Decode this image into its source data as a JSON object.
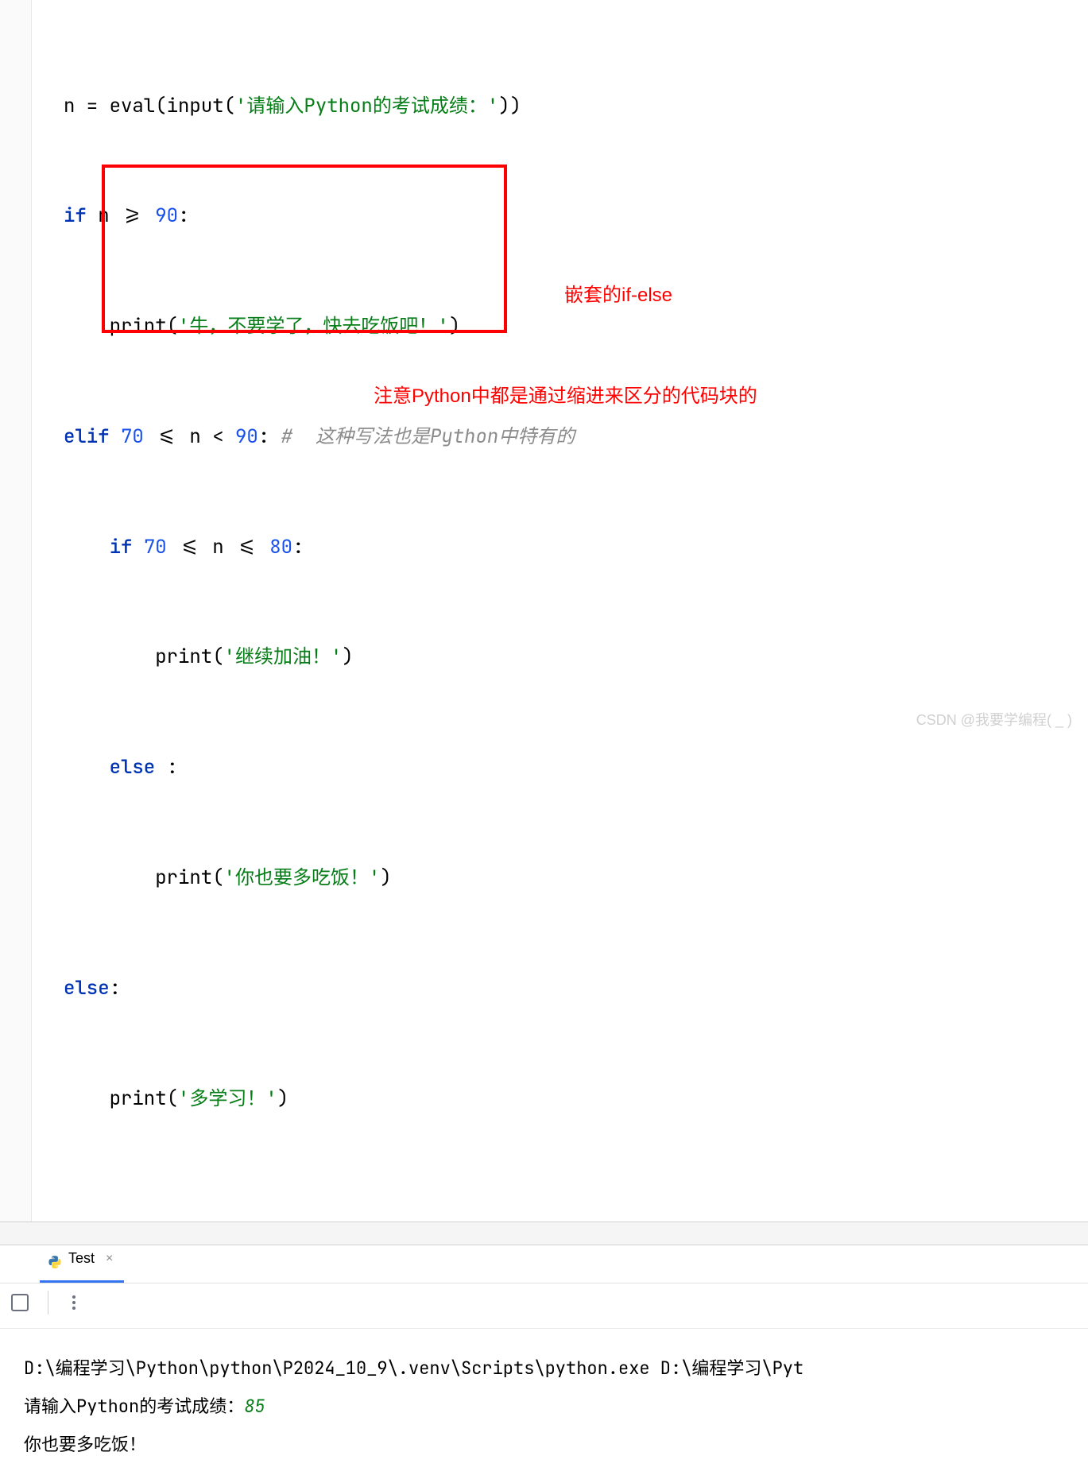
{
  "code": {
    "line1": {
      "var": "n = ",
      "fn1": "eval",
      "paren1": "(",
      "fn2": "input",
      "paren2": "(",
      "str": "'请输入Python的考试成绩：'",
      "paren3": "))"
    },
    "line2": {
      "kw": "if",
      "cond": " n >= ",
      "num": "90",
      "colon": ":"
    },
    "line3": {
      "fn": "print",
      "paren1": "(",
      "str": "'牛，不要学了，快去吃饭吧！'",
      "paren2": ")"
    },
    "line4": {
      "kw": "elif",
      "sp1": " ",
      "num1": "70",
      "op1": " <= n < ",
      "num2": "90",
      "colon": ": ",
      "comment": "#  这种写法也是Python中特有的"
    },
    "line5": {
      "kw": "if",
      "sp1": " ",
      "num1": "70",
      "op1": " <= n <= ",
      "num2": "80",
      "colon": ":"
    },
    "line6": {
      "fn": "print",
      "paren1": "(",
      "str": "'继续加油！'",
      "paren2": ")"
    },
    "line7": {
      "kw": "else",
      "colon": " :"
    },
    "line8": {
      "fn": "print",
      "paren1": "(",
      "str": "'你也要多吃饭！'",
      "paren2": ")"
    },
    "line9": {
      "kw": "else",
      "colon": ":"
    },
    "line10": {
      "fn": "print",
      "paren1": "(",
      "str": "'多学习！'",
      "paren2": ")"
    }
  },
  "annotations": {
    "box_label": "嵌套的if-else",
    "indent_note": "注意Python中都是通过缩进来区分的代码块的"
  },
  "tab": {
    "name": "Test"
  },
  "console": {
    "command": "D:\\编程学习\\Python\\python\\P2024_10_9\\.venv\\Scripts\\python.exe D:\\编程学习\\Pyt",
    "prompt": "请输入Python的考试成绩：",
    "input_value": "85",
    "output": "你也要多吃饭！"
  },
  "watermark": "CSDN @我要学编程( _ )"
}
